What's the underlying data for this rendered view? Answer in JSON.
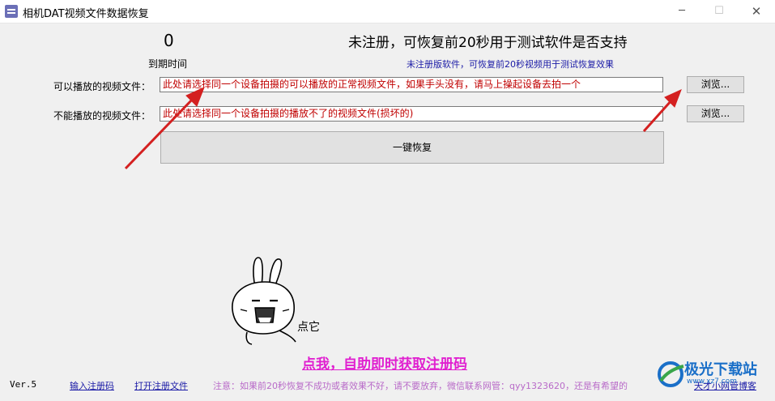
{
  "window": {
    "title": "相机DAT视频文件数据恢复",
    "minimize": "─",
    "maximize": "☐",
    "close": "✕"
  },
  "status": {
    "timer_value": "0",
    "expire_label": "到期时间",
    "registration": "未注册，可恢复前20秒用于测试软件是否支持",
    "hint": "未注册版软件，可恢复前20秒视频用于测试恢复效果"
  },
  "form": {
    "playable_label": "可以播放的视频文件：",
    "playable_value": "此处请选择同一个设备拍摄的可以播放的正常视频文件，如果手头没有，请马上操起设备去拍一个",
    "broken_label": "不能播放的视频文件：",
    "broken_value": "此处请选择同一个设备拍摄的播放不了的视频文件(损坏的)",
    "browse_label": "浏览...",
    "recover_label": "一键恢复"
  },
  "mascot": {
    "caption": "点它"
  },
  "promo": {
    "get_code": "点我，自助即时获取注册码"
  },
  "footer": {
    "version": "Ver.5",
    "input_code": "输入注册码",
    "open_file": "打开注册文件",
    "notice": "注意：如果前20秒恢复不成功或者效果不好，请不要放弃，微信联系网管：qyy1323620，还是有希望的",
    "blog": "天才小网管博客"
  },
  "watermark": {
    "text": "极光下载站",
    "url": "www.xz7.com"
  },
  "colors": {
    "field_text": "#c00000",
    "hint_blue": "#1a1aa6",
    "promo_magenta": "#e020d0",
    "arrow_red": "#d42020"
  }
}
